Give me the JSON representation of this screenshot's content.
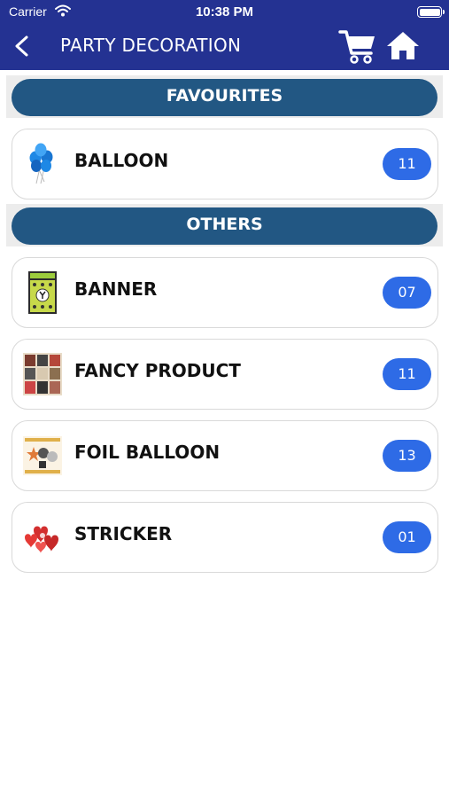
{
  "status_bar": {
    "carrier": "Carrier",
    "time": "10:38 PM"
  },
  "header": {
    "title": "PARTY DECORATION",
    "back_icon": "chevron-left-icon",
    "cart_icon": "cart-icon",
    "home_icon": "home-icon"
  },
  "sections": {
    "favourites": {
      "label": "FAVOURITES",
      "items": [
        {
          "name": "BALLOON",
          "count": "11",
          "thumb": "balloon-thumbnail"
        }
      ]
    },
    "others": {
      "label": "OTHERS",
      "items": [
        {
          "name": "BANNER",
          "count": "07",
          "thumb": "banner-thumbnail"
        },
        {
          "name": "FANCY PRODUCT",
          "count": "11",
          "thumb": "fancy-product-thumbnail"
        },
        {
          "name": "FOIL BALLOON",
          "count": "13",
          "thumb": "foil-balloon-thumbnail"
        },
        {
          "name": "STRICKER",
          "count": "01",
          "thumb": "sticker-thumbnail"
        }
      ]
    }
  },
  "colors": {
    "header": "#243292",
    "section_pill": "#225783",
    "count_badge": "#2e6be6"
  }
}
